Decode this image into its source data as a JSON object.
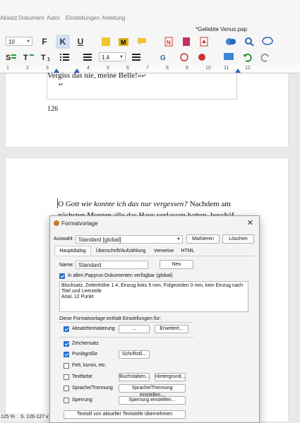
{
  "menu": [
    "Absatz",
    "Dokument",
    "Autor",
    "Einstellungen",
    "Anleitung"
  ],
  "document_title": "*Geliebte Venus.pap",
  "toolbar": {
    "font_size": "10",
    "line_spacing": "1.4",
    "bold_label": "F",
    "italic_label": "K",
    "underline_label": "U"
  },
  "ruler": [
    "1",
    "2",
    "3",
    "4",
    "5",
    "6",
    "7",
    "8",
    "9",
    "10",
    "11",
    "12"
  ],
  "page1": {
    "line": "Vergiss das nie, meine Belle!«",
    "page_number": "126"
  },
  "page2": {
    "line1_italic": "O Gott wie konnte ich das nur vergessen?",
    "line1_rest": " Nachdem am",
    "line2": "nächsten Morgen alle das Haus verlassen hatten, beschäf"
  },
  "dialog": {
    "title": "Formatvorlage",
    "selection_label": "Auswahl:",
    "selection_value": "Standard [global]",
    "mark_button": "Markieren",
    "delete_button": "Löschen",
    "tabs": [
      "Hauptdialog",
      "Überschrift/Aufzählung",
      "Verweise",
      "HTML"
    ],
    "name_label": "Name:",
    "name_value": "Standard",
    "new_button": "Neu",
    "all_docs_label": "in allen Papyrus-Dokumenten verfügbar (global)",
    "description": "Blocksatz, Zeilenhöhe 1.4, Einzug links 5 mm, Folgezeilen 0 mm, kein Einzug nach Titel und Leerzeile\nArial, 12 Punkt",
    "contains_label": "Diese Formatvorlage enthält Einstellungen für:",
    "settings": [
      {
        "label": "Absatzformatierung",
        "checked": true
      },
      {
        "label": "Zeichensatz",
        "checked": true
      },
      {
        "label": "Punktgröße",
        "checked": true
      },
      {
        "label": "Fett, kursiv, etc.",
        "checked": false
      },
      {
        "label": "Textfarbe",
        "checked": false
      },
      {
        "label": "Sprache/Trennung",
        "checked": false
      },
      {
        "label": "Sperrung",
        "checked": false
      }
    ],
    "btn_dots": "...",
    "btn_extended": "Erweitert...",
    "btn_fontstyle": "Schriftstil...",
    "btn_letters": "Buchstaben...",
    "btn_background": "Hintergrund...",
    "btn_language": "Sprache/Trennung einstellen...",
    "btn_spacing": "Sperrung einstellen...",
    "btn_take_style": "Textstil von aktueller Textstelle übernehmen"
  },
  "status": {
    "zoom": "125 %",
    "page": "S. 126-127 v"
  }
}
